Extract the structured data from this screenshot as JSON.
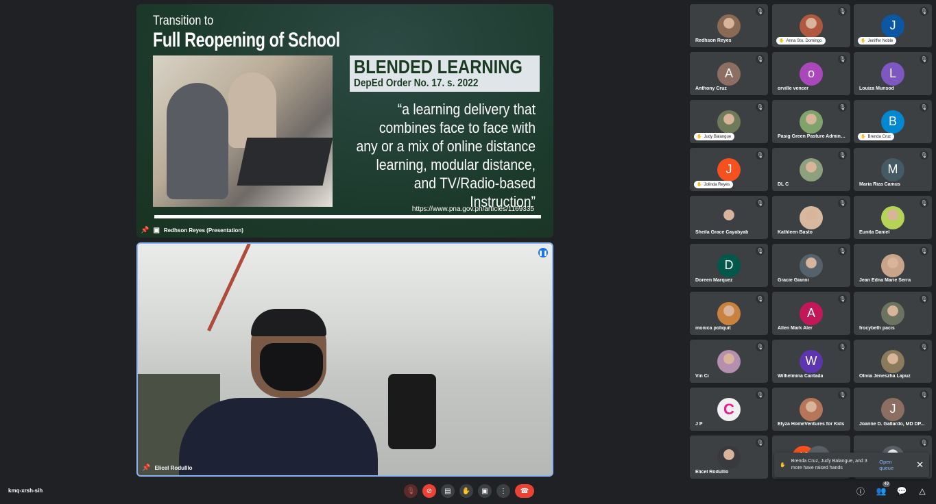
{
  "presentation": {
    "title_line1": "Transition to",
    "title_line2": "Full Reopening of School",
    "heading": "BLENDED LEARNING",
    "subheading": "DepEd Order No. 17. s. 2022",
    "quote": "“a learning delivery that combines face to face with any or a mix of online distance learning, modular distance, and TV/Radio-based Instruction”",
    "url": "https://www.pna.gov.ph/articles/1169335",
    "presenter_label": "Redhson Reyes (Presentation)"
  },
  "speaker": {
    "name": "Elicel Rodulllo"
  },
  "participants": [
    {
      "name": "Redhson Reyes",
      "photo": "#8a6a55",
      "hand": false
    },
    {
      "name": "Anna Sto. Domingo",
      "photo": "#b0593f",
      "hand": true
    },
    {
      "name": "Jeniffer Noble",
      "letter": "J",
      "color": "#0b57a4",
      "hand": true
    },
    {
      "name": "Anthony Cruz",
      "letter": "A",
      "color": "#8d6e63",
      "hand": false
    },
    {
      "name": "orville vencer",
      "letter": "o",
      "color": "#ab47bc",
      "hand": false
    },
    {
      "name": "Louiza Munsod",
      "letter": "L",
      "color": "#7e57c2",
      "hand": false
    },
    {
      "name": "Judy Balangue",
      "photo": "#6f7a5a",
      "hand": true
    },
    {
      "name": "Pasig Green Pasture Adminis...",
      "photo": "#7fa36a",
      "hand": false
    },
    {
      "name": "Brenda Cruz",
      "letter": "B",
      "color": "#0288d1",
      "hand": true
    },
    {
      "name": "Jolinda Reyes",
      "letter": "J",
      "color": "#f4511e",
      "hand": true
    },
    {
      "name": "DL C",
      "photo": "#8fa07e",
      "hand": false
    },
    {
      "name": "Maria Riza Camus",
      "letter": "M",
      "color": "#455a64",
      "hand": false
    },
    {
      "name": "Sheila Grace Cayabyab",
      "photo": "#3d3f45",
      "hand": false
    },
    {
      "name": "Kathleen Basto",
      "photo": "#d9b8a0",
      "hand": false
    },
    {
      "name": "Eunita Daniel",
      "photo": "#b6d357",
      "hand": false
    },
    {
      "name": "Doreen Marquez",
      "letter": "D",
      "color": "#00574b",
      "hand": false
    },
    {
      "name": "Gracie Gianni",
      "photo": "#55626b",
      "hand": false
    },
    {
      "name": "Jean Edna Marie Serra",
      "photo": "#c9a38a",
      "hand": false
    },
    {
      "name": "monica poliquit",
      "photo": "#c9823d",
      "hand": false
    },
    {
      "name": "Allen Mark Aler",
      "letter": "A",
      "color": "#c2185b",
      "hand": false
    },
    {
      "name": "frocybeth pacis",
      "photo": "#6c7360",
      "hand": false
    },
    {
      "name": "Vin Ci",
      "photo": "#b48fb0",
      "hand": false
    },
    {
      "name": "Wilhelmina Cantada",
      "letter": "W",
      "color": "#5e35b1",
      "hand": false
    },
    {
      "name": "Olivia Jeneszha Lapuz",
      "photo": "#8b7b5c",
      "hand": false
    },
    {
      "name": "J P",
      "letter": "C",
      "color": "#f0f0f0",
      "hand": false
    },
    {
      "name": "Elyza HomeVentures for Kids",
      "photo": "#b7765a",
      "hand": false
    },
    {
      "name": "Joanne D. Gallardo, MD DP...",
      "letter": "J",
      "color": "#8d6e63",
      "hand": false
    },
    {
      "name": "Elicel Rodulllo",
      "photo": "#3a3a3e",
      "hand": false
    },
    {
      "name": "",
      "letter": "K",
      "color": "#f4511e",
      "hand": false
    },
    {
      "name": "",
      "photo": "#5a5f66",
      "hand": false
    }
  ],
  "toast": {
    "message": "Brenda Cruz, Judy Balangue, and 3 more have raised hands",
    "action": "Open queue"
  },
  "meeting_code": "kmq-xrsh-sih",
  "participant_count": "49"
}
